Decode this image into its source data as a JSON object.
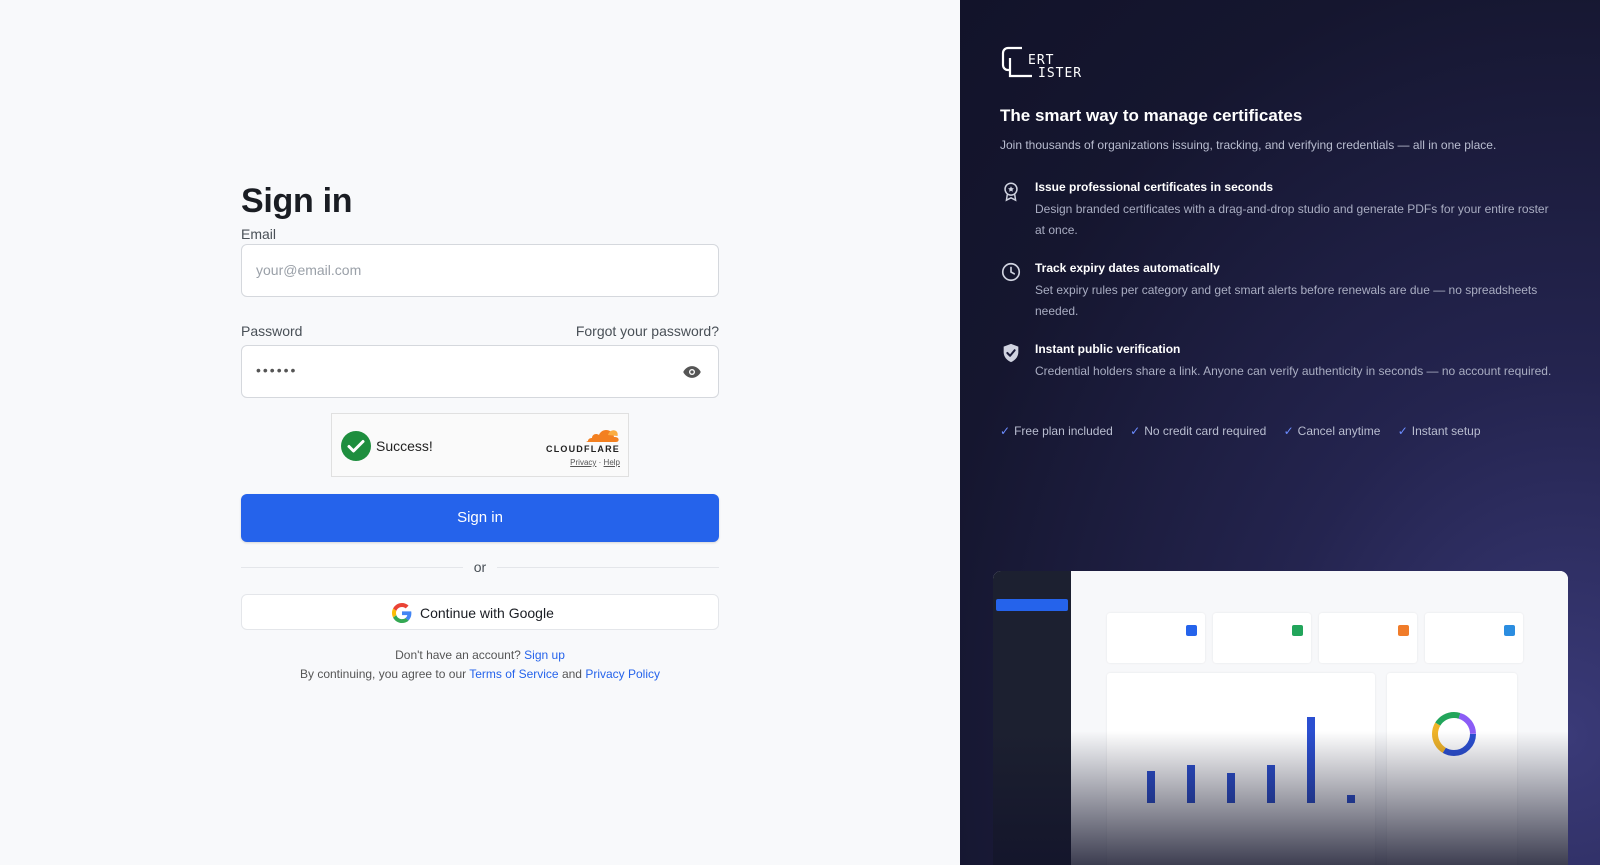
{
  "signin": {
    "title": "Sign in",
    "email_label": "Email",
    "email_placeholder": "your@email.com",
    "password_label": "Password",
    "forgot_label": "Forgot your password?",
    "password_value": "••••••",
    "captcha": {
      "status": "Success!",
      "brand": "CLOUDFLARE",
      "privacy": "Privacy",
      "separator": "·",
      "help": "Help"
    },
    "submit_label": "Sign in",
    "or_label": "or",
    "google_label": "Continue with Google",
    "signup_prompt": "Don't have an account?",
    "signup_link": "Sign up",
    "terms_prefix": "By continuing, you agree to our",
    "terms_link": "Terms of Service",
    "terms_and": "and",
    "privacy_link": "Privacy Policy"
  },
  "promo": {
    "logo_alt": "CERT LISTER",
    "title": "The smart way to manage certificates",
    "subtitle": "Join thousands of organizations issuing, tracking, and verifying credentials — all in one place.",
    "features": [
      {
        "icon": "badge-icon",
        "title": "Issue professional certificates in seconds",
        "desc": "Design branded certificates with a drag-and-drop studio and generate PDFs for your entire roster at once."
      },
      {
        "icon": "clock-icon",
        "title": "Track expiry dates automatically",
        "desc": "Set expiry rules per category and get smart alerts before renewals are due — no spreadsheets needed."
      },
      {
        "icon": "shield-check-icon",
        "title": "Instant public verification",
        "desc": "Credential holders share a link. Anyone can verify authenticity in seconds — no account required."
      }
    ],
    "perks": [
      "Free plan included",
      "No credit card required",
      "Cancel anytime",
      "Instant setup"
    ]
  },
  "colors": {
    "primary": "#2563eb",
    "promo_bg": "#15162f",
    "success": "#1e8e3e",
    "cloudflare": "#f38020"
  }
}
